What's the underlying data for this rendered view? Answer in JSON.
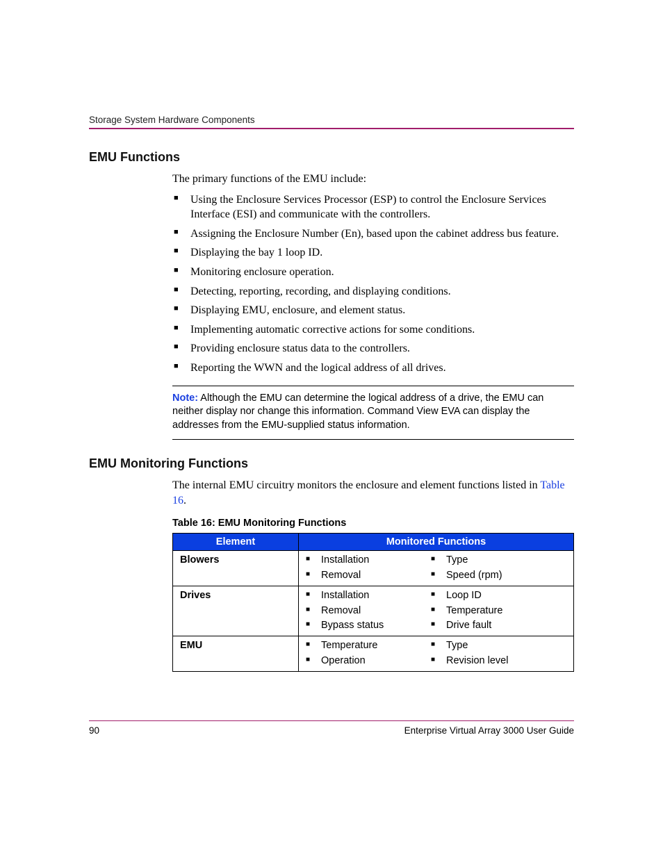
{
  "header": {
    "running_title": "Storage System Hardware Components"
  },
  "section1": {
    "title": "EMU Functions",
    "intro": "The primary functions of the EMU include:",
    "items": [
      "Using the Enclosure Services Processor (ESP) to control the Enclosure Services Interface (ESI) and communicate with the controllers.",
      "Assigning the Enclosure Number (En), based upon the cabinet address bus feature.",
      "Displaying the bay 1 loop ID.",
      "Monitoring enclosure operation.",
      "Detecting, reporting, recording, and displaying conditions.",
      "Displaying EMU, enclosure, and element status.",
      "Implementing automatic corrective actions for some conditions.",
      "Providing enclosure status data to the controllers.",
      "Reporting the WWN and the logical address of all drives."
    ],
    "note_label": "Note:",
    "note_body": "Although the EMU can determine the logical address of a drive, the EMU can neither display nor change this information. Command View EVA can display the addresses from the EMU-supplied status information."
  },
  "section2": {
    "title": "EMU Monitoring Functions",
    "intro_pre": "The internal EMU circuitry monitors the enclosure and element functions listed in ",
    "intro_link": "Table 16",
    "intro_post": ".",
    "table_caption": "Table 16:  EMU Monitoring Functions",
    "table": {
      "head_col1": "Element",
      "head_col2": "Monitored Functions",
      "rows": [
        {
          "element": "Blowers",
          "left": [
            "Installation",
            "Removal"
          ],
          "right": [
            "Type",
            "Speed (rpm)"
          ]
        },
        {
          "element": "Drives",
          "left": [
            "Installation",
            "Removal",
            "Bypass status"
          ],
          "right": [
            "Loop ID",
            "Temperature",
            "Drive fault"
          ]
        },
        {
          "element": "EMU",
          "left": [
            "Temperature",
            "Operation"
          ],
          "right": [
            "Type",
            "Revision level"
          ]
        }
      ]
    }
  },
  "footer": {
    "page_num": "90",
    "doc_title": "Enterprise Virtual Array 3000 User Guide"
  }
}
